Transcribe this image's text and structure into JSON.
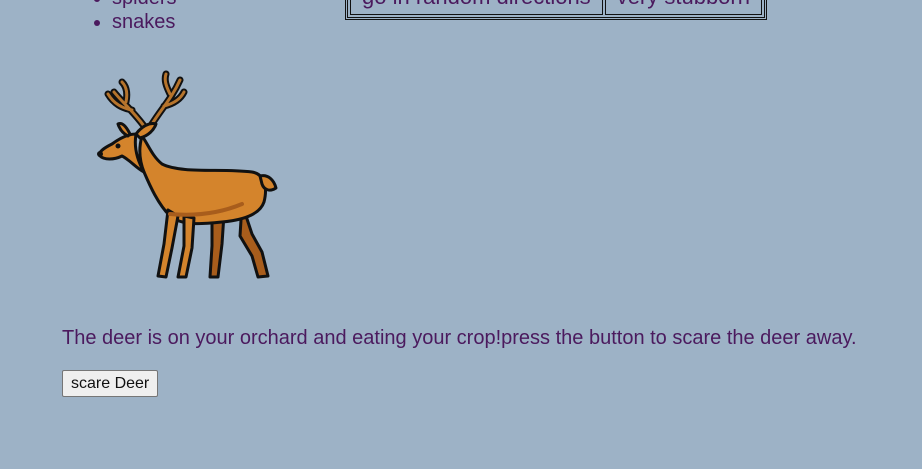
{
  "threats_list": {
    "items": [
      "spiders",
      "snakes"
    ]
  },
  "traits_table": {
    "cells": [
      "go in random directions",
      "very stubborn"
    ]
  },
  "deer": {
    "icon": "deer-illustration",
    "colors": {
      "body": "#d4842c",
      "shadow": "#a85d1c",
      "outline": "#111111"
    }
  },
  "message": {
    "text": "The deer is on your orchard and eating your crop!press the button to scare the deer away."
  },
  "button": {
    "label": "scare Deer"
  },
  "colors": {
    "background": "#9db2c6",
    "text": "#4b1a5e"
  }
}
